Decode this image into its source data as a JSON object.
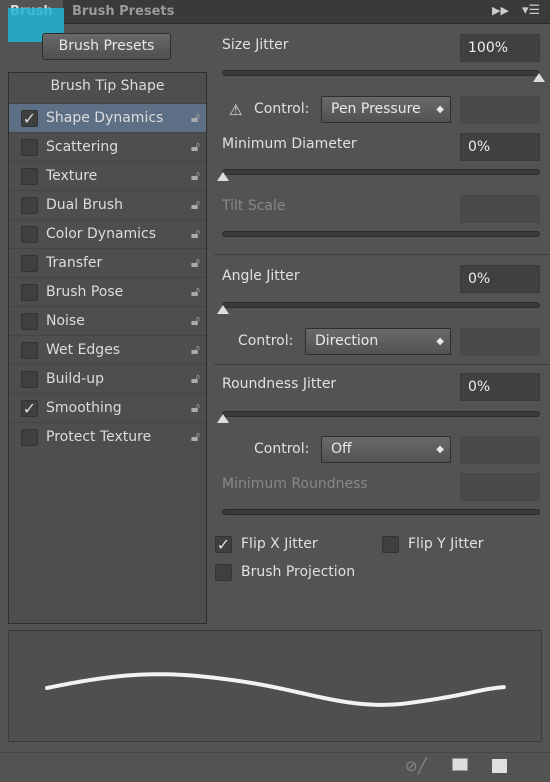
{
  "tabs": [
    {
      "label": "Brush",
      "active": true
    },
    {
      "label": "Brush Presets",
      "active": false
    }
  ],
  "brush_presets_button": "Brush Presets",
  "list": {
    "header": "Brush Tip Shape",
    "items": [
      {
        "label": "Shape Dynamics",
        "checked": true,
        "selected": true
      },
      {
        "label": "Scattering",
        "checked": false
      },
      {
        "label": "Texture",
        "checked": false
      },
      {
        "label": "Dual Brush",
        "checked": false
      },
      {
        "label": "Color Dynamics",
        "checked": false
      },
      {
        "label": "Transfer",
        "checked": false
      },
      {
        "label": "Brush Pose",
        "checked": false
      },
      {
        "label": "Noise",
        "checked": false
      },
      {
        "label": "Wet Edges",
        "checked": false
      },
      {
        "label": "Build-up",
        "checked": false
      },
      {
        "label": "Smoothing",
        "checked": true
      },
      {
        "label": "Protect Texture",
        "checked": false
      }
    ]
  },
  "size_jitter": {
    "label": "Size Jitter",
    "value": "100%",
    "level": 100
  },
  "control1": {
    "label": "Control:",
    "value": "Pen Pressure",
    "warning_icon": "warning-icon"
  },
  "min_diameter": {
    "label": "Minimum Diameter",
    "value": "0%",
    "level": 0
  },
  "tilt_scale": {
    "label": "Tilt Scale"
  },
  "angle_jitter": {
    "label": "Angle Jitter",
    "value": "0%",
    "level": 0
  },
  "control2": {
    "label": "Control:",
    "value": "Direction"
  },
  "roundness_jitter": {
    "label": "Roundness Jitter",
    "value": "0%",
    "level": 0
  },
  "control3": {
    "label": "Control:",
    "value": "Off"
  },
  "min_roundness": {
    "label": "Minimum Roundness"
  },
  "flip_x": {
    "label": "Flip X Jitter",
    "checked": true
  },
  "flip_y": {
    "label": "Flip Y Jitter",
    "checked": false
  },
  "brush_projection": {
    "label": "Brush Projection",
    "checked": false
  },
  "check_mark": "✓"
}
